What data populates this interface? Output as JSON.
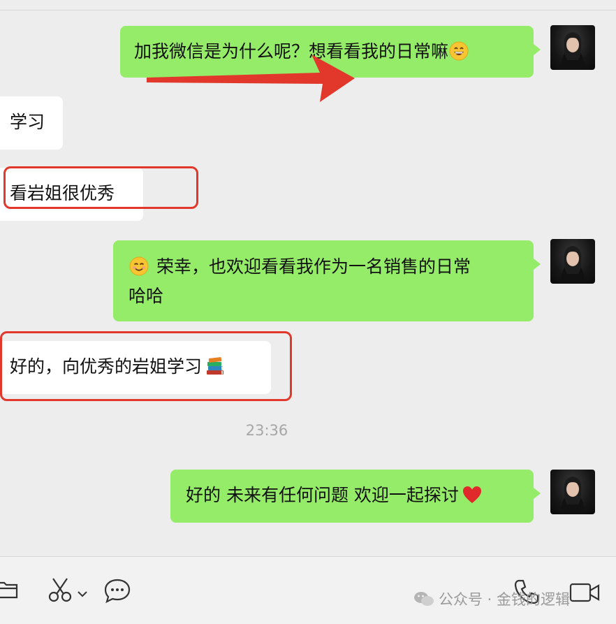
{
  "chat": {
    "messages": [
      {
        "side": "sent",
        "text": "加我微信是为什么呢？想看看我的日常嘛",
        "emoji": "grinning-face"
      },
      {
        "side": "received",
        "text": "学习"
      },
      {
        "side": "received",
        "text": "看岩姐很优秀"
      },
      {
        "side": "sent",
        "emoji": "smiling-face",
        "text": "荣幸，也欢迎看看我作为一名销售的日常",
        "text_line2": "哈哈"
      },
      {
        "side": "received",
        "text": "好的，向优秀的岩姐学习",
        "emoji": "books"
      },
      {
        "side": "sent",
        "text": "好的 未来有任何问题 欢迎一起探讨",
        "emoji": "red-heart"
      }
    ],
    "timestamp": "23:36"
  },
  "annotations": {
    "highlight_color": "#e2372b",
    "arrow_color": "#e2372b"
  },
  "toolbar": {
    "icons": [
      "folder-icon",
      "scissors-icon",
      "chevron-down-icon",
      "chat-bubble-icon",
      "phone-icon",
      "video-icon"
    ]
  },
  "watermark": {
    "text": "公众号 · 金钱的逻辑"
  },
  "colors": {
    "sent_bubble": "#95ec69",
    "received_bubble": "#ffffff",
    "background": "#ededed"
  }
}
